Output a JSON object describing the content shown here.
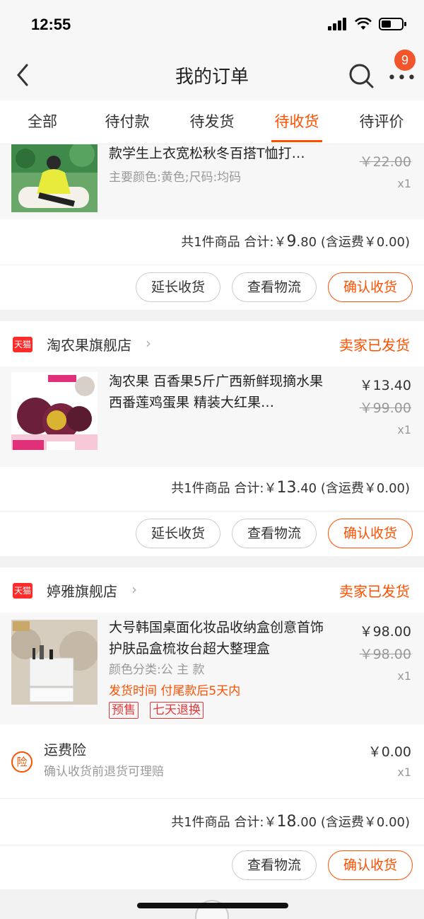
{
  "status": {
    "time": "12:55"
  },
  "nav": {
    "title": "我的订单",
    "badge": "9",
    "more": "•••"
  },
  "tabs": [
    {
      "label": "全部"
    },
    {
      "label": "待付款"
    },
    {
      "label": "待发货"
    },
    {
      "label": "待收货",
      "active": true
    },
    {
      "label": "待评价"
    }
  ],
  "order1": {
    "item": {
      "title": "款学生上衣宽松秋冬百搭T恤打…",
      "sub": "主要颜色:黄色;尺码:均码",
      "orig_price": "￥22.00",
      "qty": "x1"
    },
    "summary": {
      "count": "共1件商品",
      "total_label": "合计:￥",
      "total_int": "9",
      "total_dec": ".80",
      "shipping": "(含运费￥0.00)"
    },
    "buttons": {
      "extend": "延长收货",
      "logistics": "查看物流",
      "confirm": "确认收货"
    }
  },
  "order2": {
    "shop": {
      "badge": "天猫",
      "name": "淘农果旗舰店",
      "status": "卖家已发货"
    },
    "item": {
      "title": "淘农果 百香果5斤广西新鲜现摘水果西番莲鸡蛋果 精装大红果…",
      "price": "￥13.40",
      "orig_price": "￥99.00",
      "qty": "x1"
    },
    "summary": {
      "count": "共1件商品",
      "total_label": "合计:￥",
      "total_int": "13",
      "total_dec": ".40",
      "shipping": "(含运费￥0.00)"
    },
    "buttons": {
      "extend": "延长收货",
      "logistics": "查看物流",
      "confirm": "确认收货"
    }
  },
  "order3": {
    "shop": {
      "badge": "天猫",
      "name": "婷雅旗舰店",
      "status": "卖家已发货"
    },
    "item": {
      "title": "大号韩国桌面化妆品收纳盒创意首饰护肤品盒梳妆台超大整理盒",
      "sub": "颜色分类:公 主 款",
      "presale_info": "发货时间 付尾款后5天内",
      "tags": [
        "预售",
        "七天退换"
      ],
      "price": "￥98.00",
      "orig_price": "￥98.00",
      "qty": "x1"
    },
    "insurance": {
      "icon": "险",
      "title": "运费险",
      "desc": "确认收货前退货可理赔",
      "price": "￥0.00",
      "qty": "x1"
    },
    "summary": {
      "count": "共1件商品",
      "total_label": "合计:￥",
      "total_int": "18",
      "total_dec": ".00",
      "shipping": "(含运费￥0.00)"
    },
    "buttons": {
      "logistics": "查看物流",
      "confirm": "确认收货"
    }
  },
  "colors": {
    "accent": "#ff5000",
    "tmall": "#ff2a2a",
    "badge": "#f2552c"
  }
}
